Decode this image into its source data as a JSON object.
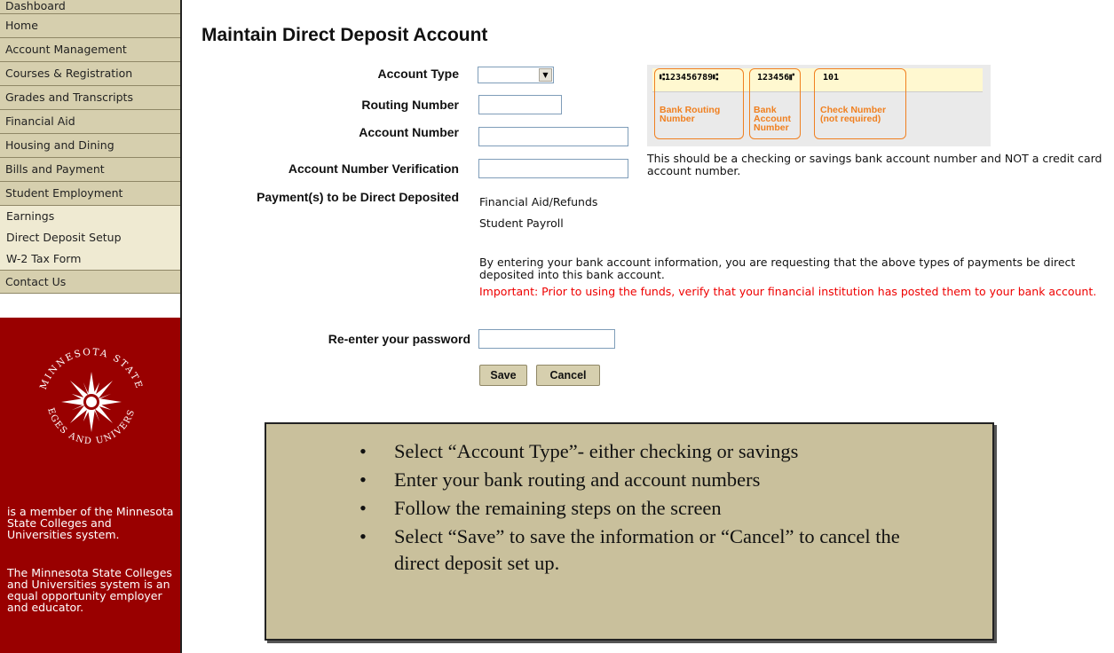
{
  "sidebar": {
    "items": [
      {
        "label": "Dashboard"
      },
      {
        "label": "Home"
      },
      {
        "label": "Account Management"
      },
      {
        "label": "Courses & Registration"
      },
      {
        "label": "Grades and Transcripts"
      },
      {
        "label": "Financial Aid"
      },
      {
        "label": "Housing and Dining"
      },
      {
        "label": "Bills and Payment"
      },
      {
        "label": "Student Employment"
      }
    ],
    "subitems": [
      {
        "label": "Earnings"
      },
      {
        "label": "Direct Deposit Setup"
      },
      {
        "label": "W-2 Tax Form"
      }
    ],
    "contact": "Contact Us",
    "logo_text": "MINNESOTA STATE COLLEGES AND UNIVERSITIES",
    "member_text": "is a member of the Minnesota State Colleges and Universities system.",
    "eo_text": "The Minnesota State Colleges and Universities system is an equal opportunity employer and educator."
  },
  "page": {
    "title": "Maintain Direct Deposit Account"
  },
  "form": {
    "account_type_label": "Account Type",
    "account_type_value": "",
    "routing_label": "Routing Number",
    "routing_value": "",
    "account_label": "Account Number",
    "account_value": "",
    "verify_label": "Account Number Verification",
    "verify_value": "",
    "account_note": "This should be a checking or savings bank account number and NOT a credit card account number.",
    "payments_label": "Payment(s) to be Direct Deposited",
    "payments": [
      "Financial Aid/Refunds",
      "Student Payroll"
    ],
    "consent_text": "By entering your bank account information, you are requesting that the above types of payments be direct deposited into this bank account.",
    "important_text": "Important: Prior to using the funds, verify that your financial institution has posted them to your bank account.",
    "password_label": "Re-enter your password",
    "password_value": "",
    "save_label": "Save",
    "cancel_label": "Cancel"
  },
  "check_image": {
    "routing_digits": "⑆123456789⑆",
    "account_digits": "123456⑈",
    "check_digits": "101",
    "routing_caption": "Bank Routing Number",
    "account_caption": "Bank Account Number",
    "check_caption": "Check Number (not required)",
    "accent_color": "#f08020"
  },
  "instructions": {
    "items": [
      "Select “Account Type”- either checking or savings",
      "Enter your bank routing and account numbers",
      "Follow the remaining steps on the screen",
      "Select “Save” to save the information or “Cancel” to cancel the direct deposit set up."
    ]
  },
  "colors": {
    "nav_bg": "#d6cfae",
    "subnav_bg": "#efead2",
    "brand_red": "#990000",
    "instructions_bg": "#c9c09c",
    "warning_red": "#ee0000"
  }
}
